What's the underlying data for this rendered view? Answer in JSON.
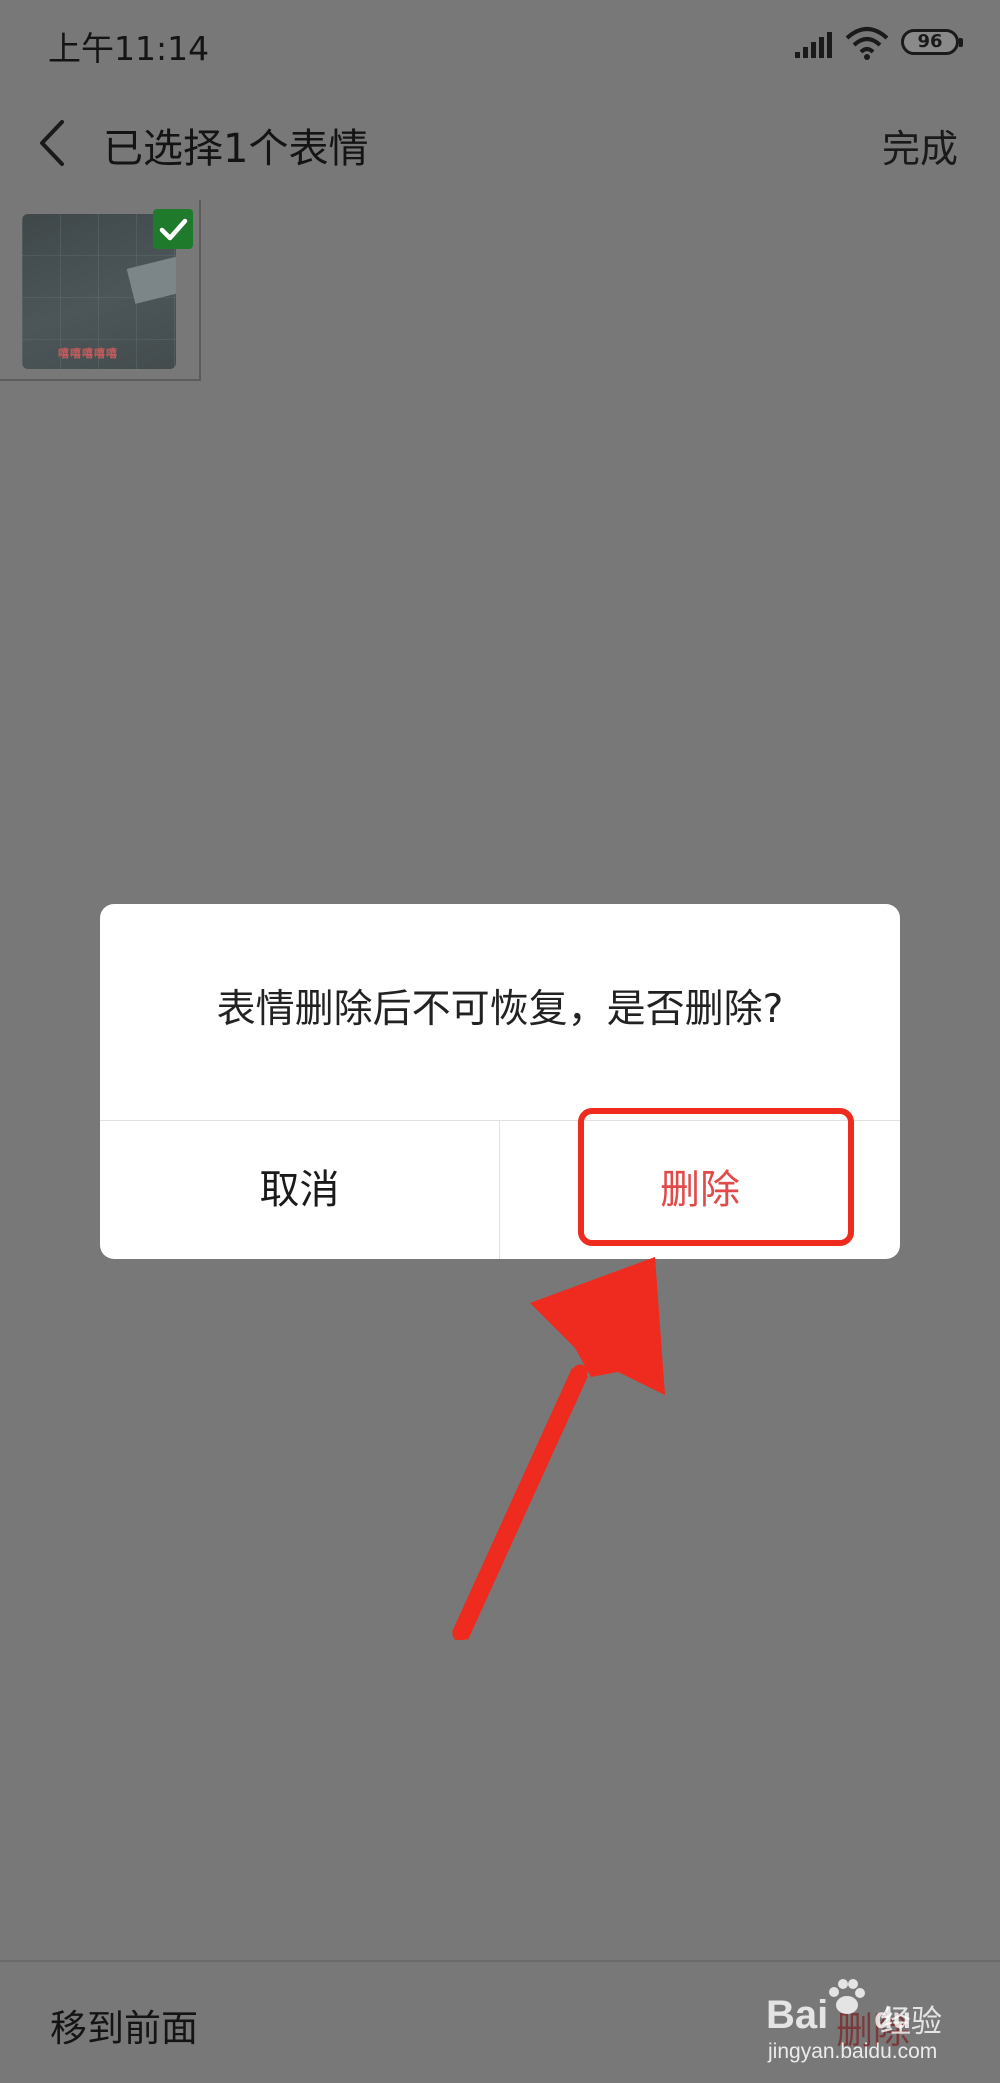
{
  "status_bar": {
    "time": "上午11:14",
    "battery_level": "96",
    "icons": [
      "signal-icon",
      "wifi-icon",
      "battery-icon"
    ]
  },
  "nav": {
    "back_icon": "chevron-left-icon",
    "title": "已选择1个表情",
    "done_label": "完成"
  },
  "stickers": [
    {
      "selected": true,
      "caption": "嘻嘻嘻嘻嘻",
      "check_icon": "checkmark-icon"
    }
  ],
  "dialog": {
    "message": "表情删除后不可恢复，是否删除?",
    "cancel_label": "取消",
    "delete_label": "删除"
  },
  "annotation": {
    "highlight_color": "#ee2b1e",
    "arrow_color": "#ee2b1e"
  },
  "bottom_bar": {
    "move_front_label": "移到前面",
    "delete_label": "删除"
  },
  "watermark": {
    "logo_text": "Bai",
    "logo_suffix": "du",
    "brand": "经验",
    "url": "jingyan.baidu.com"
  }
}
